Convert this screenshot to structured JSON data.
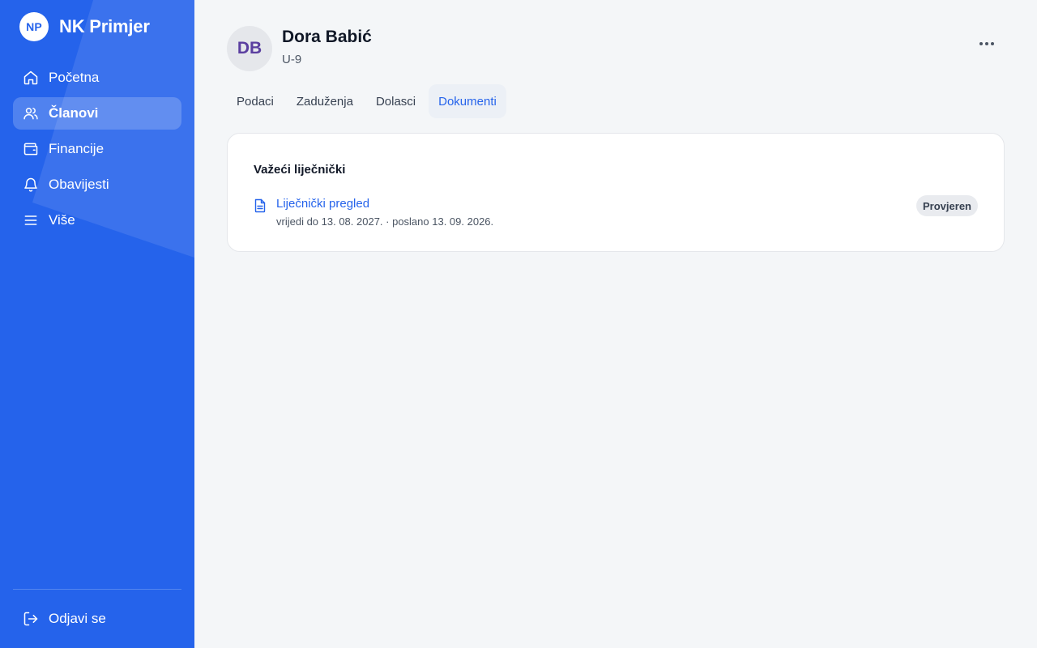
{
  "brand": {
    "logo_text": "NP",
    "name": "NK Primjer"
  },
  "sidebar": {
    "items": [
      {
        "label": "Početna",
        "icon": "home-icon",
        "active": false
      },
      {
        "label": "Članovi",
        "icon": "users-icon",
        "active": true
      },
      {
        "label": "Financije",
        "icon": "wallet-icon",
        "active": false
      },
      {
        "label": "Obavijesti",
        "icon": "bell-icon",
        "active": false
      },
      {
        "label": "Više",
        "icon": "menu-icon",
        "active": false
      }
    ],
    "logout_label": "Odjavi se"
  },
  "member": {
    "initials": "DB",
    "name": "Dora Babić",
    "group": "U-9"
  },
  "tabs": [
    {
      "label": "Podaci",
      "active": false
    },
    {
      "label": "Zaduženja",
      "active": false
    },
    {
      "label": "Dolasci",
      "active": false
    },
    {
      "label": "Dokumenti",
      "active": true
    }
  ],
  "documents": {
    "section_title": "Važeći liječnički",
    "items": [
      {
        "title": "Liječnički pregled",
        "meta": "vrijedi do 13. 08. 2027. · poslano 13. 09. 2026.",
        "status": "Provjeren"
      }
    ]
  },
  "colors": {
    "primary": "#2563eb",
    "background": "#f4f6f8",
    "avatar_text": "#5b3fa0"
  }
}
